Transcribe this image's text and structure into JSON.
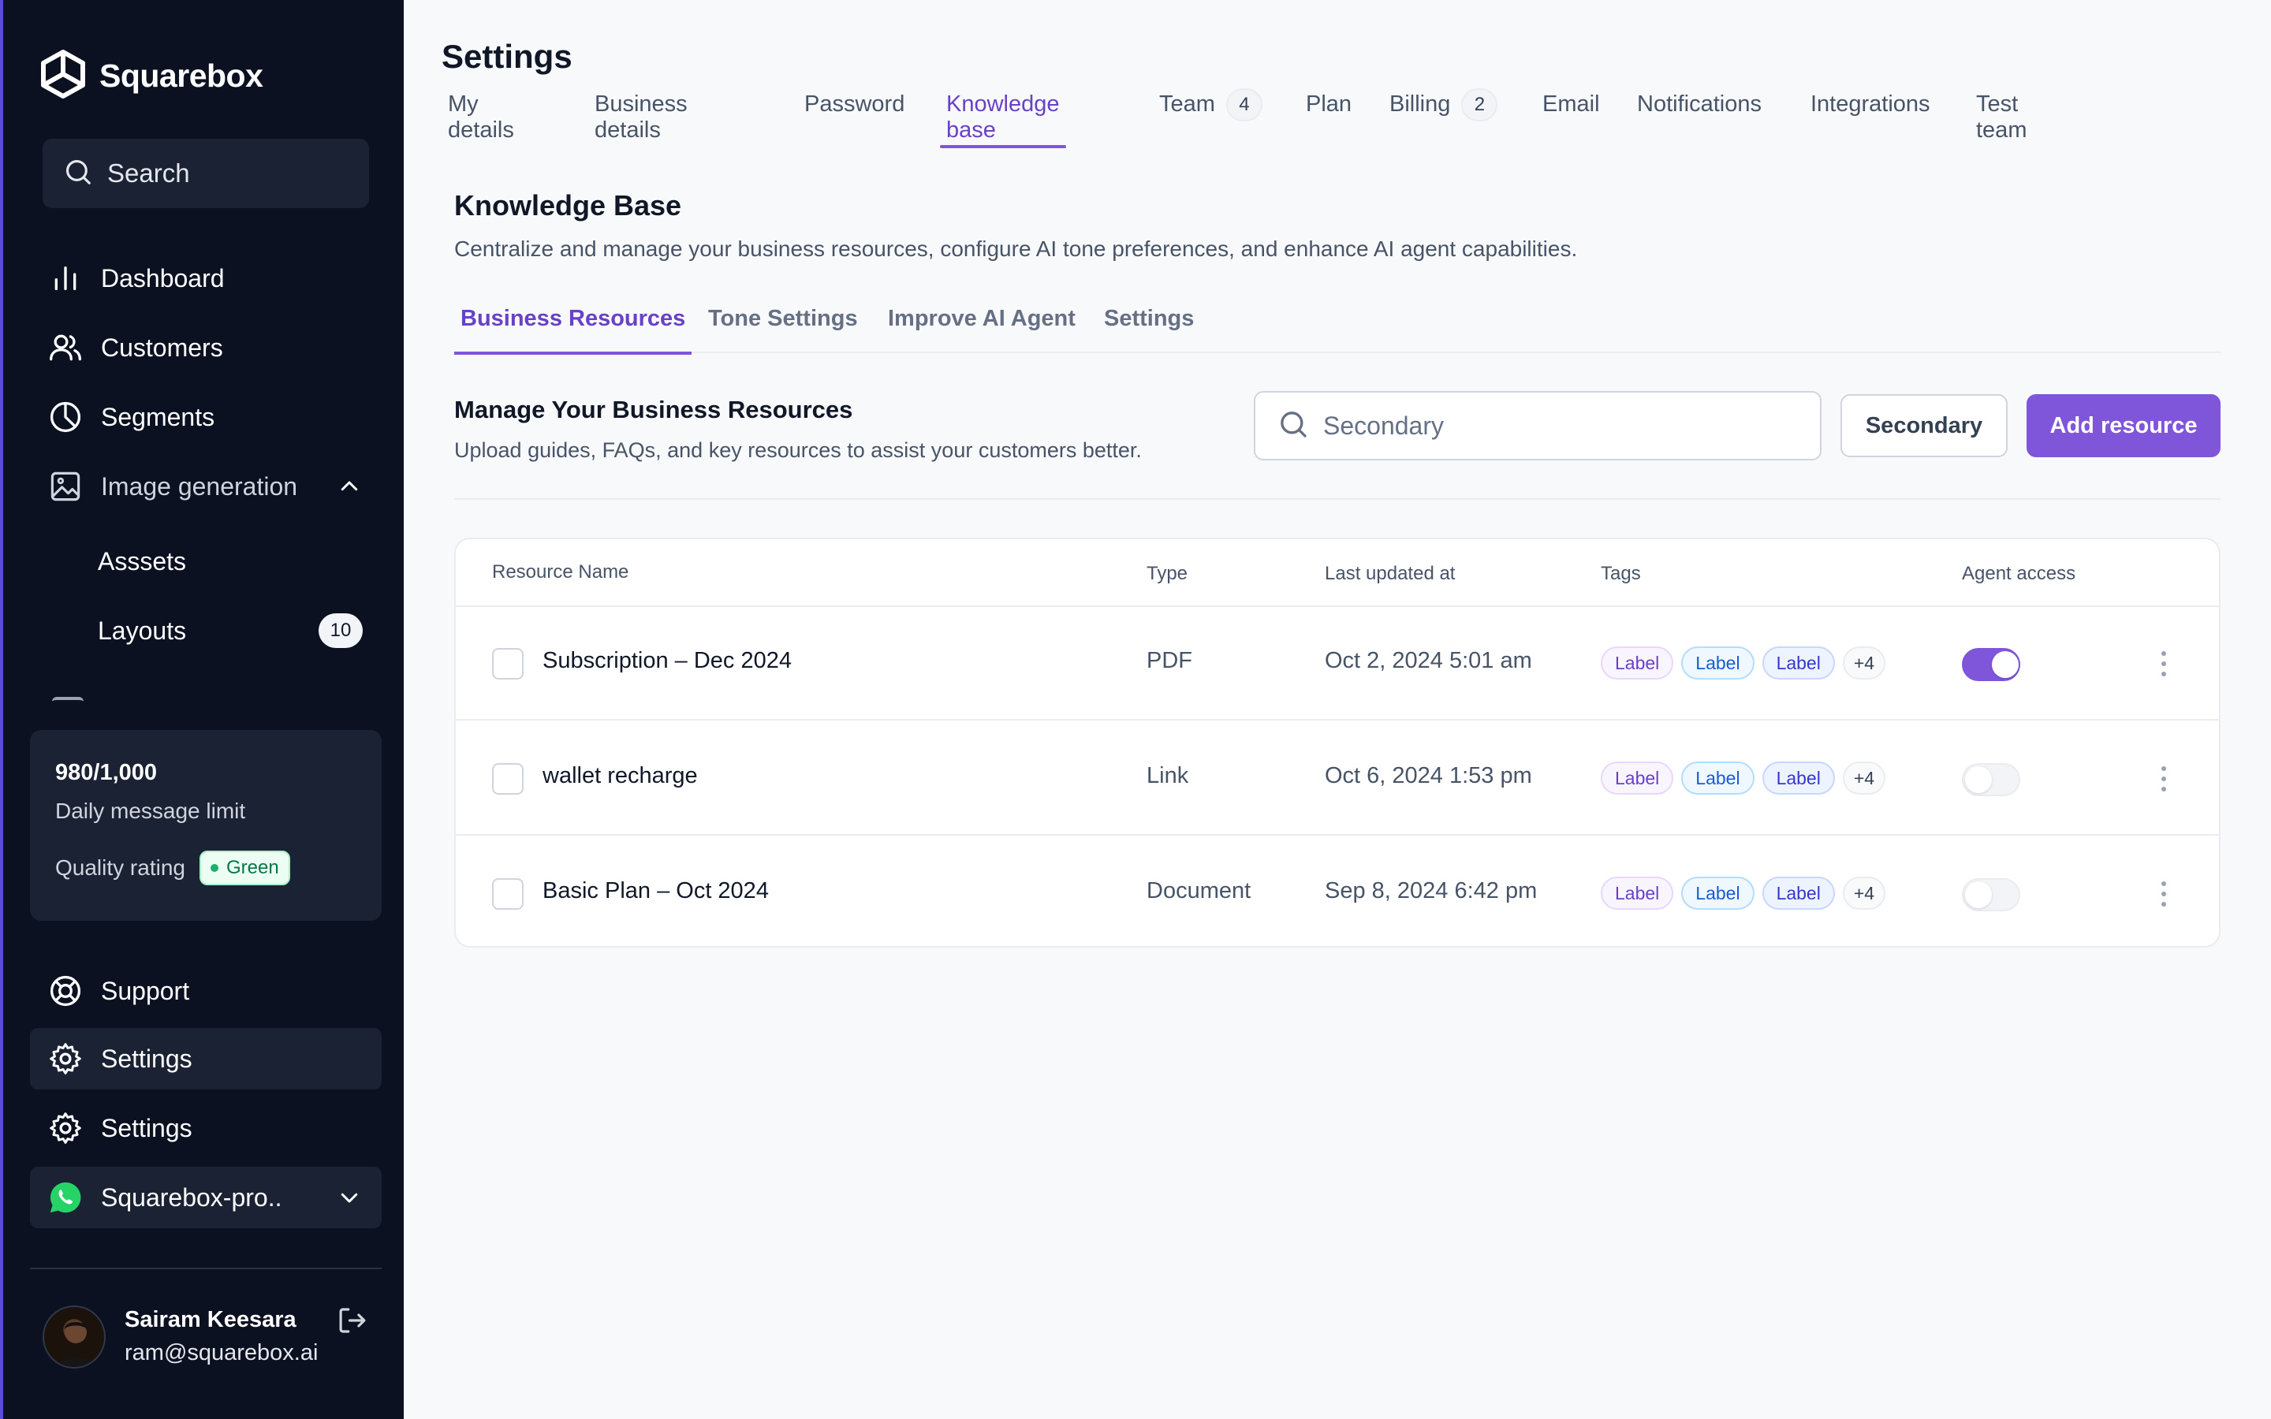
{
  "sidebar": {
    "brand": "Squarebox",
    "search_label": "Search",
    "nav": {
      "dashboard": "Dashboard",
      "customers": "Customers",
      "segments": "Segments",
      "image_generation": "Image generation",
      "assets": "Asssets",
      "layouts": "Layouts",
      "layouts_badge": "10",
      "support": "Support",
      "settings_active": "Settings",
      "settings": "Settings",
      "workspace": "Squarebox-pro.."
    },
    "limit_card": {
      "count": "980/1,000",
      "label": "Daily message limit",
      "quality_label": "Quality rating",
      "quality_value": "Green"
    },
    "profile": {
      "name": "Sairam Keesara",
      "email": "ram@squarebox.ai"
    }
  },
  "main": {
    "title": "Settings",
    "tabs": [
      {
        "label": "My details"
      },
      {
        "label": "Business details"
      },
      {
        "label": "Password"
      },
      {
        "label": "Knowledge base",
        "active": true
      },
      {
        "label": "Team",
        "count": "4"
      },
      {
        "label": "Plan"
      },
      {
        "label": "Billing",
        "count": "2"
      },
      {
        "label": "Email"
      },
      {
        "label": "Notifications"
      },
      {
        "label": "Integrations"
      },
      {
        "label": "Test team"
      }
    ],
    "kb": {
      "title": "Knowledge Base",
      "description": "Centralize and manage your business resources, configure AI tone preferences, and enhance AI agent capabilities."
    },
    "sub_tabs": [
      {
        "label": "Business Resources",
        "active": true
      },
      {
        "label": "Tone Settings"
      },
      {
        "label": "Improve AI Agent"
      },
      {
        "label": "Settings"
      }
    ],
    "resources": {
      "title": "Manage Your Business Resources",
      "description": "Upload guides, FAQs, and key resources to assist your customers better.",
      "search_placeholder": "Secondary",
      "secondary_button": "Secondary",
      "primary_button": "Add resource"
    },
    "table": {
      "headers": {
        "name": "Resource Name",
        "type": "Type",
        "updated": "Last updated at",
        "tags": "Tags",
        "access": "Agent access"
      },
      "rows": [
        {
          "name": "Subscription – Dec 2024",
          "type": "PDF",
          "updated": "Oct 2, 2024 5:01 am",
          "tags": [
            "Label",
            "Label",
            "Label"
          ],
          "more": "+4",
          "agent_access": true
        },
        {
          "name": "wallet recharge",
          "type": "Link",
          "updated": "Oct 6, 2024 1:53 pm",
          "tags": [
            "Label",
            "Label",
            "Label"
          ],
          "more": "+4",
          "agent_access": false
        },
        {
          "name": "Basic Plan – Oct 2024",
          "type": "Document",
          "updated": "Sep 8, 2024 6:42 pm",
          "tags": [
            "Label",
            "Label",
            "Label"
          ],
          "more": "+4",
          "agent_access": false
        }
      ]
    }
  },
  "colors": {
    "sidebar_bg": "#0c1122",
    "accent": "#7f56d9",
    "accent_text": "#6941c6",
    "quality_green": "#17b26a"
  }
}
